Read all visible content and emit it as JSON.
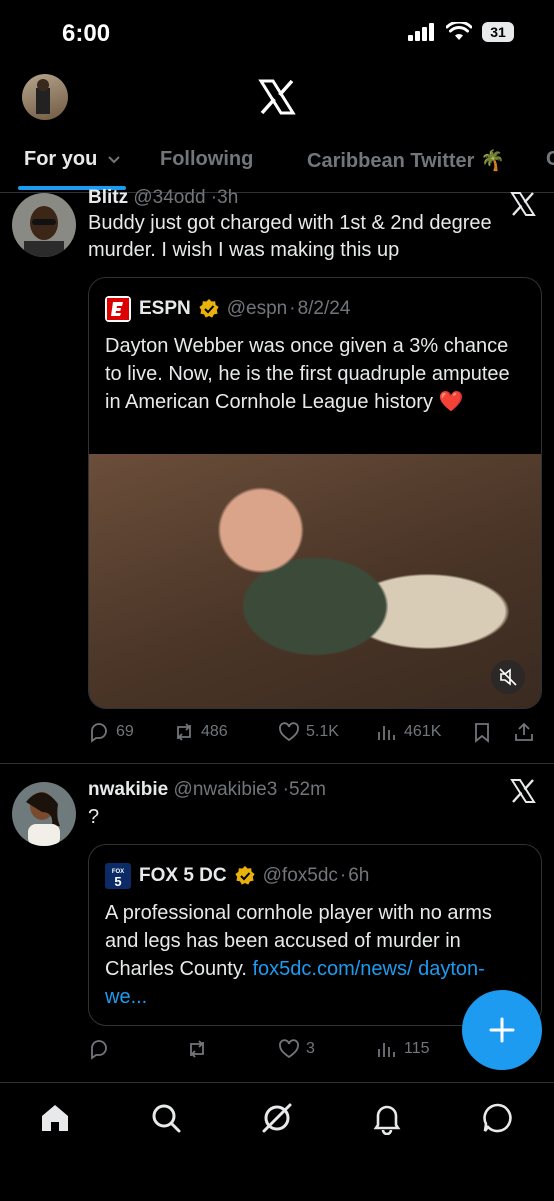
{
  "status_bar": {
    "time": "6:00",
    "battery": "31"
  },
  "tabs": [
    {
      "label": "For you"
    },
    {
      "label": "Following"
    },
    {
      "label": "Caribbean Twitter 🌴"
    },
    {
      "label": "C"
    }
  ],
  "tweets": [
    {
      "name": "Blitz",
      "handle": "@34odd",
      "time": "3h",
      "text": "Buddy just got charged with 1st & 2nd degree murder. I wish I was making this up",
      "quote": {
        "name": "ESPN",
        "handle": "@espn",
        "date": "8/2/24",
        "text": "Dayton Webber was once given a 3% chance to live. Now, he is the first quadruple amputee in American Cornhole League history ❤️"
      },
      "actions": {
        "replies": "69",
        "reposts": "486",
        "likes": "5.1K",
        "views": "461K"
      }
    },
    {
      "name": "nwakibie",
      "handle": "@nwakibie3",
      "time": "52m",
      "text": "?",
      "quote": {
        "name": "FOX 5 DC",
        "handle": "@fox5dc",
        "date": "6h",
        "text": "A professional cornhole player with no arms and legs has been accused of murder in Charles County.",
        "link": "fox5dc.com/news/ dayton-we..."
      },
      "actions": {
        "replies": "",
        "reposts": "",
        "likes": "3",
        "views": "115"
      }
    }
  ],
  "colors": {
    "accent": "#1d9bf0",
    "background": "#000000",
    "muted": "#71767b",
    "heart": "#e0245e"
  },
  "icons": [
    "x-logo-icon",
    "verified-icon",
    "reply-icon",
    "repost-icon",
    "like-icon",
    "views-icon",
    "bookmark-icon",
    "share-icon",
    "mute-icon",
    "compose-icon",
    "home-icon",
    "search-icon",
    "grok-icon",
    "notifications-icon",
    "messages-icon"
  ]
}
